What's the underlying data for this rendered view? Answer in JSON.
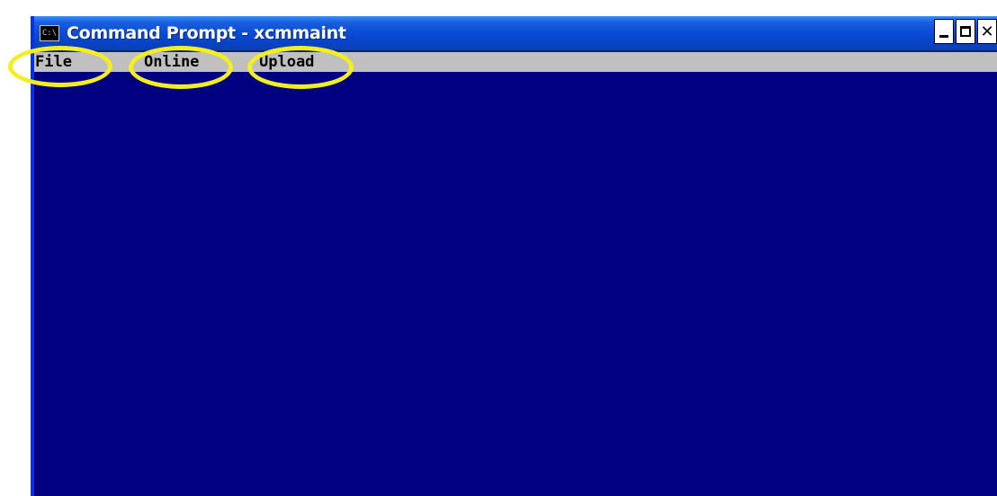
{
  "window": {
    "title": "Command Prompt - xcmmaint",
    "icon": "console-app-icon",
    "icon_text": "C:\\",
    "controls": [
      "minimize",
      "maximize",
      "close"
    ],
    "close_glyph": "✕"
  },
  "menu": {
    "items": [
      {
        "label": "File"
      },
      {
        "label": "Online"
      },
      {
        "label": "Upload"
      }
    ]
  },
  "colors": {
    "titlebar": "#0a4ad6",
    "menubar": "#c0c0c0",
    "console_background": "#000080",
    "highlight": "#f5ee1f"
  }
}
